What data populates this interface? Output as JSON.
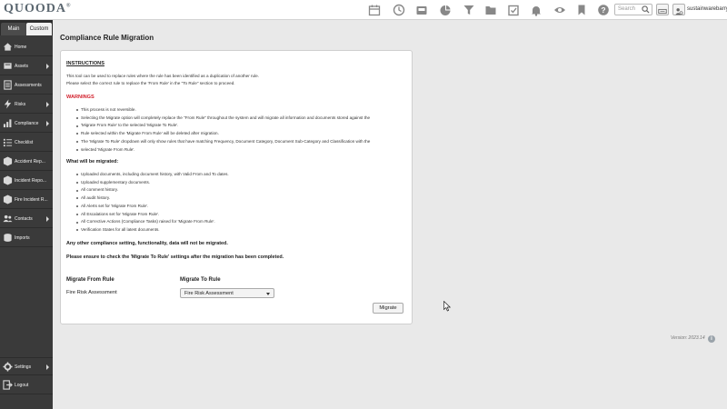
{
  "app": {
    "logo": "QUOODA",
    "logo_mark": "®"
  },
  "topbar": {
    "icons": [
      "calendar-icon",
      "clock-icon",
      "inbox-icon",
      "pie-chart-icon",
      "filter-icon",
      "folder-icon",
      "checklist-icon",
      "bell-icon",
      "eye-icon",
      "bookmark-icon",
      "help-icon"
    ],
    "search_placeholder": "Search",
    "user_name": "sustainwarebarry"
  },
  "sidebar": {
    "tabs": [
      "Main",
      "Custom"
    ],
    "items": [
      {
        "label": "Home",
        "icon": "home-icon",
        "arrow": false
      },
      {
        "label": "Assets",
        "icon": "assets-icon",
        "arrow": true
      },
      {
        "label": "Assessments",
        "icon": "assessments-icon",
        "arrow": false
      },
      {
        "label": "Risks",
        "icon": "risks-icon",
        "arrow": true
      },
      {
        "label": "Compliance",
        "icon": "compliance-icon",
        "arrow": true
      },
      {
        "label": "Checklist",
        "icon": "checklist-icon",
        "arrow": false
      },
      {
        "label": "Accident Rep...",
        "icon": "accident-icon",
        "arrow": false
      },
      {
        "label": "Incident Repo...",
        "icon": "incident-icon",
        "arrow": false
      },
      {
        "label": "Fire Incident R...",
        "icon": "fire-incident-icon",
        "arrow": false
      },
      {
        "label": "Contacts",
        "icon": "contacts-icon",
        "arrow": true
      },
      {
        "label": "Imports",
        "icon": "imports-icon",
        "arrow": false
      }
    ],
    "bottom_items": [
      {
        "label": "Settings",
        "icon": "gear-icon",
        "arrow": true
      },
      {
        "label": "Logout",
        "icon": "logout-icon",
        "arrow": false
      }
    ]
  },
  "page": {
    "title": "Compliance Rule Migration",
    "instructions_heading": "INSTRUCTIONS",
    "instructions_lines": [
      "This tool can be used to replace rules where the rule has been identified as a duplication of another rule.",
      "Please select the correct rule to replace the 'From Rule' in the \"To Rule\" section to proceed."
    ],
    "warnings_heading": "WARNINGS",
    "warnings": [
      "This process is not reversible.",
      "Selecting the Migrate option will completely replace the \"From Rule\" throughout the system and will migrate all information and documents stored against the",
      "'Migrate From Rule' to the selected 'Migrate To Rule'.",
      "Rule selected within the 'Migrate From Rule' will be deleted after migration.",
      "The 'Migrate To Rule' dropdown will only show rules that have matching Frequency, Document Category, Document Sub-Category and Classification with the",
      "selected 'Migrate From Rule'."
    ],
    "migrated_heading": "What will be migrated:",
    "migrated_items": [
      "Uploaded documents, including document history, with Valid From and To dates.",
      "Uploaded supplementary documents.",
      "All comment history.",
      "All audit history.",
      "All Alerts set for 'Migrate From Rule'.",
      "All Escalations set for 'Migrate From Rule'.",
      "All Corrective Actions (Compliance Tasks) raised for 'Migrate From Rule'.",
      "Verification States for all latest documents."
    ],
    "note1": "Any other compliance setting, functionality, data will not be migrated.",
    "note2": "Please ensure to check the 'Migrate To Rule' settings after the migration has been completed.",
    "from_label": "Migrate From Rule",
    "from_value": "Fire Risk Assessment",
    "to_label": "Migrate To Rule",
    "to_selected": "Fire Risk Assessment",
    "migrate_button": "Migrate"
  },
  "footer": {
    "version": "Version: 2023.14",
    "info_icon": "info-icon"
  }
}
